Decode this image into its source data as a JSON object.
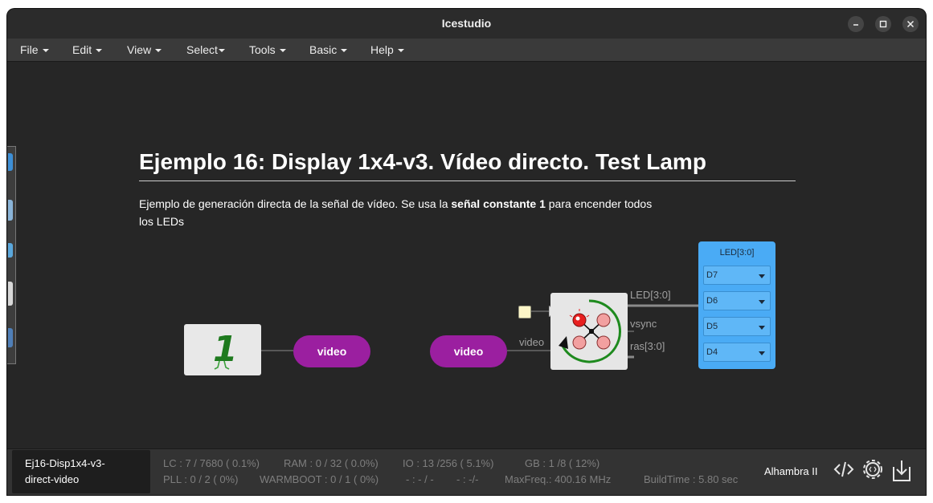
{
  "window": {
    "title": "Icestudio"
  },
  "menubar": {
    "items": [
      {
        "label": "File"
      },
      {
        "label": "Edit"
      },
      {
        "label": "View"
      },
      {
        "label": "Select"
      },
      {
        "label": "Tools"
      },
      {
        "label": "Basic"
      },
      {
        "label": "Help"
      }
    ]
  },
  "canvas": {
    "heading": "Ejemplo 16: Display 1x4-v3. Vídeo directo. Test Lamp",
    "description": {
      "part1": "Ejemplo de generación directa de la señal de vídeo. Se usa la ",
      "bold": "señal constante 1",
      "part2": " para encender todos los LEDs"
    },
    "constant_value": "1",
    "video_out_label": "video",
    "video_in_label": "video",
    "wire_video": "video",
    "port_led": "LED[3:0]",
    "port_vsync": "vsync",
    "port_ras": "ras[3:0]",
    "led_block": {
      "title": "LED[3:0]",
      "pins": [
        {
          "label": "D7"
        },
        {
          "label": "D6"
        },
        {
          "label": "D5"
        },
        {
          "label": "D4"
        }
      ]
    }
  },
  "statusbar": {
    "project_line1": "Ej16-Disp1x4-v3-",
    "project_line2": "direct-video",
    "lc": "LC : 7 / 7680 ( 0.1%)",
    "ram": "RAM : 0 / 32 ( 0.0%)",
    "io": "IO :  13 /256  ( 5.1%)",
    "gb": "GB :  1 /8  ( 12%)",
    "pll": "PLL : 0 / 2 ( 0%)",
    "warmboot": "WARMBOOT : 0 / 1 ( 0%)",
    "blank1": "- : - / -",
    "blank2": "- :  -/-",
    "maxfreq": "MaxFreq.:  400.16 MHz",
    "buildtime": "BuildTime :  5.80 sec",
    "board": "Alhambra II"
  },
  "colors": {
    "accent_purple": "#9b1fa0",
    "led_blue": "#4aabf5",
    "background": "#262626"
  }
}
